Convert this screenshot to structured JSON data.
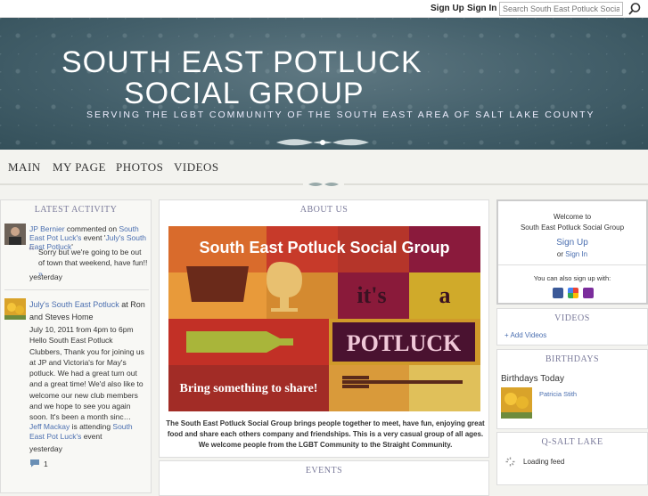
{
  "topbar": {
    "signup": "Sign Up",
    "signin": "Sign In",
    "search_placeholder": "Search South East Potluck Social"
  },
  "header": {
    "title_line1": "SOUTH EAST POTLUCK",
    "title_line2": "SOCIAL GROUP",
    "tagline": "SERVING THE LGBT COMMUNITY OF THE SOUTH EAST AREA OF SALT LAKE COUNTY"
  },
  "nav": [
    "MAIN",
    "MY PAGE",
    "PHOTOS",
    "VIDEOS"
  ],
  "latest_activity": {
    "title": "LATEST ACTIVITY",
    "item1": {
      "actor": "JP Bernier",
      "action": " commented on ",
      "target": "South East Pot Luck's",
      "action2": " event '",
      "event": "July's South East Potluck",
      "end": "'",
      "quote": "Sorry but we're going to be out of town that weekend, have fun!! ",
      "more": "»",
      "time": "yesterday"
    },
    "item2": {
      "title": "July's South East Potluck",
      "title_tail": " at Ron and Steves Home",
      "body": "July 10, 2011 from 4pm to 6pm Hello South East Potluck Clubbers, Thank you for joining us at JP and Victoria's for May's potluck. We had a great turn out and a great time! We'd also like to welcome our new club members and we hope to see you again soon.   It's been a month sinc…",
      "actor": "Jeff Mackay",
      "action": " is attending ",
      "target": "South East Pot Luck's",
      "action2": " event",
      "time": "yesterday",
      "comments": "1"
    }
  },
  "about": {
    "title": "ABOUT US",
    "banner_line1": "South East Potluck Social Group",
    "banner_its": "it's",
    "banner_a": "a",
    "banner_potluck": "POTLUCK",
    "banner_bring": "Bring something to share!",
    "text": "The South East Potluck Social Group brings people together to meet, have fun, enjoying great food and share each others company and friendships. This is a very casual group of all ages. We welcome people from the LGBT Community to the Straight Community."
  },
  "events": {
    "title": "EVENTS"
  },
  "welcome_box": {
    "line1": "Welcome to",
    "line2": "South East Potluck Social Group",
    "signup": "Sign Up",
    "or": "or ",
    "signin": "Sign In",
    "also": "You can also sign up with:"
  },
  "videos_box": {
    "title": "VIDEOS",
    "add": "Add Videos"
  },
  "birthdays_box": {
    "title": "BIRTHDAYS",
    "today": "Birthdays Today",
    "person": "Patricia Stith"
  },
  "qsalt_box": {
    "title": "Q-SALT LAKE",
    "loading": "Loading feed"
  },
  "colors": {
    "header_bg": "#44606b",
    "link": "#4b6fb0",
    "box_title": "#7a7a9a"
  }
}
